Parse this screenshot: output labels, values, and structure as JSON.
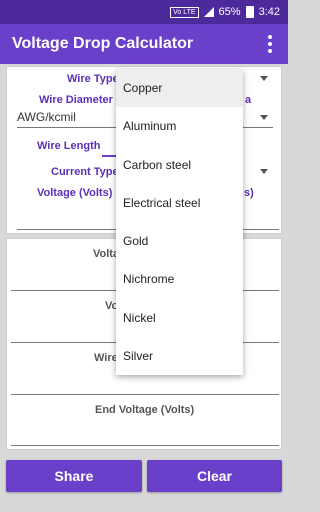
{
  "status_bar": {
    "volte": "Vo LTE",
    "battery": "65%",
    "time": "3:42"
  },
  "app_bar": {
    "title": "Voltage Drop Calculator"
  },
  "input_card": {
    "wire_type_label": "Wire Type",
    "wire_diameter_label_prefix": "Wire Diameter S",
    "wire_diameter_label_suffix": "a",
    "wire_diameter_value": "AWG/kcmil",
    "wire_length_label": "Wire Length",
    "current_type_label": "Current Type",
    "voltage_label_prefix": "Voltage (Volts)",
    "voltage_label_suffix": "s)"
  },
  "output_card": {
    "row1_label": "Volta",
    "row2_label": "Vo",
    "row3_label": "Wire",
    "end_voltage_label": "End Voltage (Volts)"
  },
  "buttons": {
    "share": "Share",
    "clear": "Clear"
  },
  "dropdown": {
    "selected": "Copper",
    "items": [
      "Copper",
      "Aluminum",
      "Carbon steel",
      "Electrical steel",
      "Gold",
      "Nichrome",
      "Nickel",
      "Silver"
    ]
  },
  "colors": {
    "primary": "#6a3fc9",
    "primary_dark": "#4d2a9c",
    "label": "#5b30b8"
  }
}
